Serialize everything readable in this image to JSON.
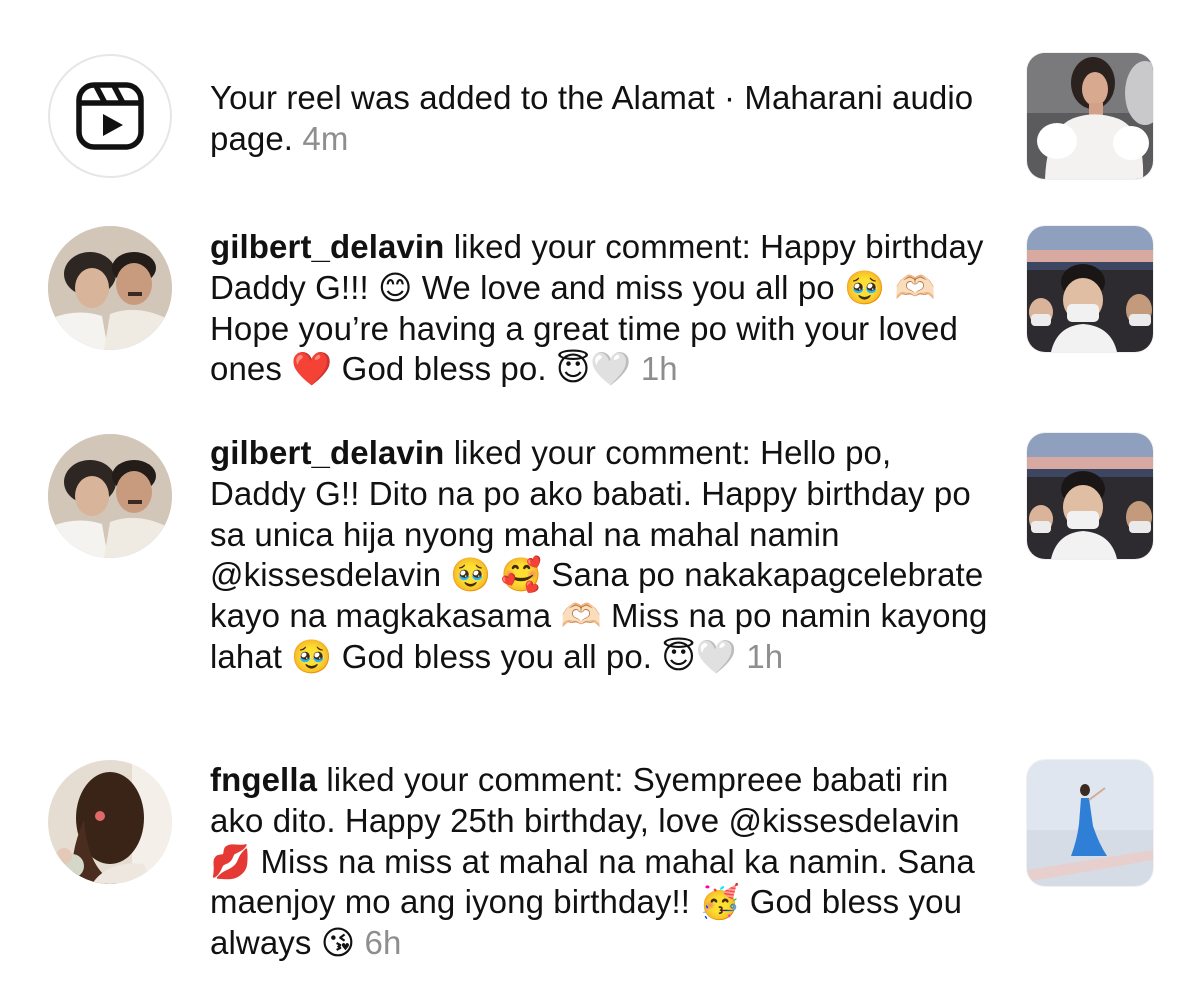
{
  "notifications": [
    {
      "type": "reel-added",
      "text": "Your reel was added to the Alamat · Maharani audio page.",
      "time": "4m"
    },
    {
      "type": "comment-like",
      "username": "gilbert_delavin",
      "text": "liked your comment: Happy birthday Daddy G!!! 😊 We love and miss you all po 🥹 🫶🏻 Hope you’re having a great time po with your loved ones ❤️ God bless po. 😇🤍",
      "time": "1h"
    },
    {
      "type": "comment-like",
      "username": "gilbert_delavin",
      "text": "liked your comment: Hello po, Daddy G!! Dito na po ako babati. Happy birthday po sa unica hija nyong mahal na mahal namin @kissesdelavin 🥹 🥰 Sana po nakakapagcelebrate kayo na magkakasama 🫶🏻 Miss na po namin kayong lahat 🥹 God bless you all po. 😇🤍",
      "time": "1h"
    },
    {
      "type": "comment-like",
      "username": "fngella",
      "text": "liked your comment: Syempreee babati rin ako dito. Happy 25th birthday, love @kissesdelavin 💋 Miss na miss at mahal na mahal ka namin. Sana maenjoy mo ang iyong birthday!! 🥳 God bless you always 😘",
      "time": "6h"
    }
  ],
  "icons": {
    "reel": "reels-icon"
  },
  "colors": {
    "text": "#111111",
    "timestamp": "#8e8e8e",
    "background": "#ffffff"
  }
}
